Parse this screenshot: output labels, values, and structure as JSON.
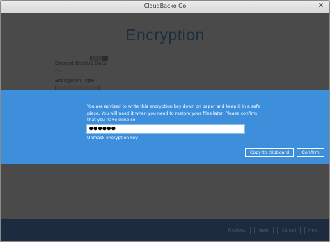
{
  "window": {
    "title": "CloudBacko Go"
  },
  "page": {
    "title": "Encryption",
    "encrypt_label": "Encrypt Backup Data",
    "encrypt_value": "On",
    "encryption_type_label": "Encryption Type"
  },
  "dialog": {
    "message": "You are advised to write this encryption key down on paper and keep it in a safe place. You will need it when you need to restore your files later. Please confirm that you have done so.",
    "key_masked": "●●●●●●",
    "unmask_link": "Unmask encryption key",
    "copy_button": "Copy to clipboard",
    "confirm_button": "Confirm"
  },
  "footer": {
    "previous": "Previous",
    "next": "Next",
    "cancel": "Cancel",
    "help": "Help"
  },
  "colors": {
    "dialog_band": "#3d8fdc",
    "footer_bar": "#1c2b3d",
    "overlay": "#4a4a4a"
  }
}
